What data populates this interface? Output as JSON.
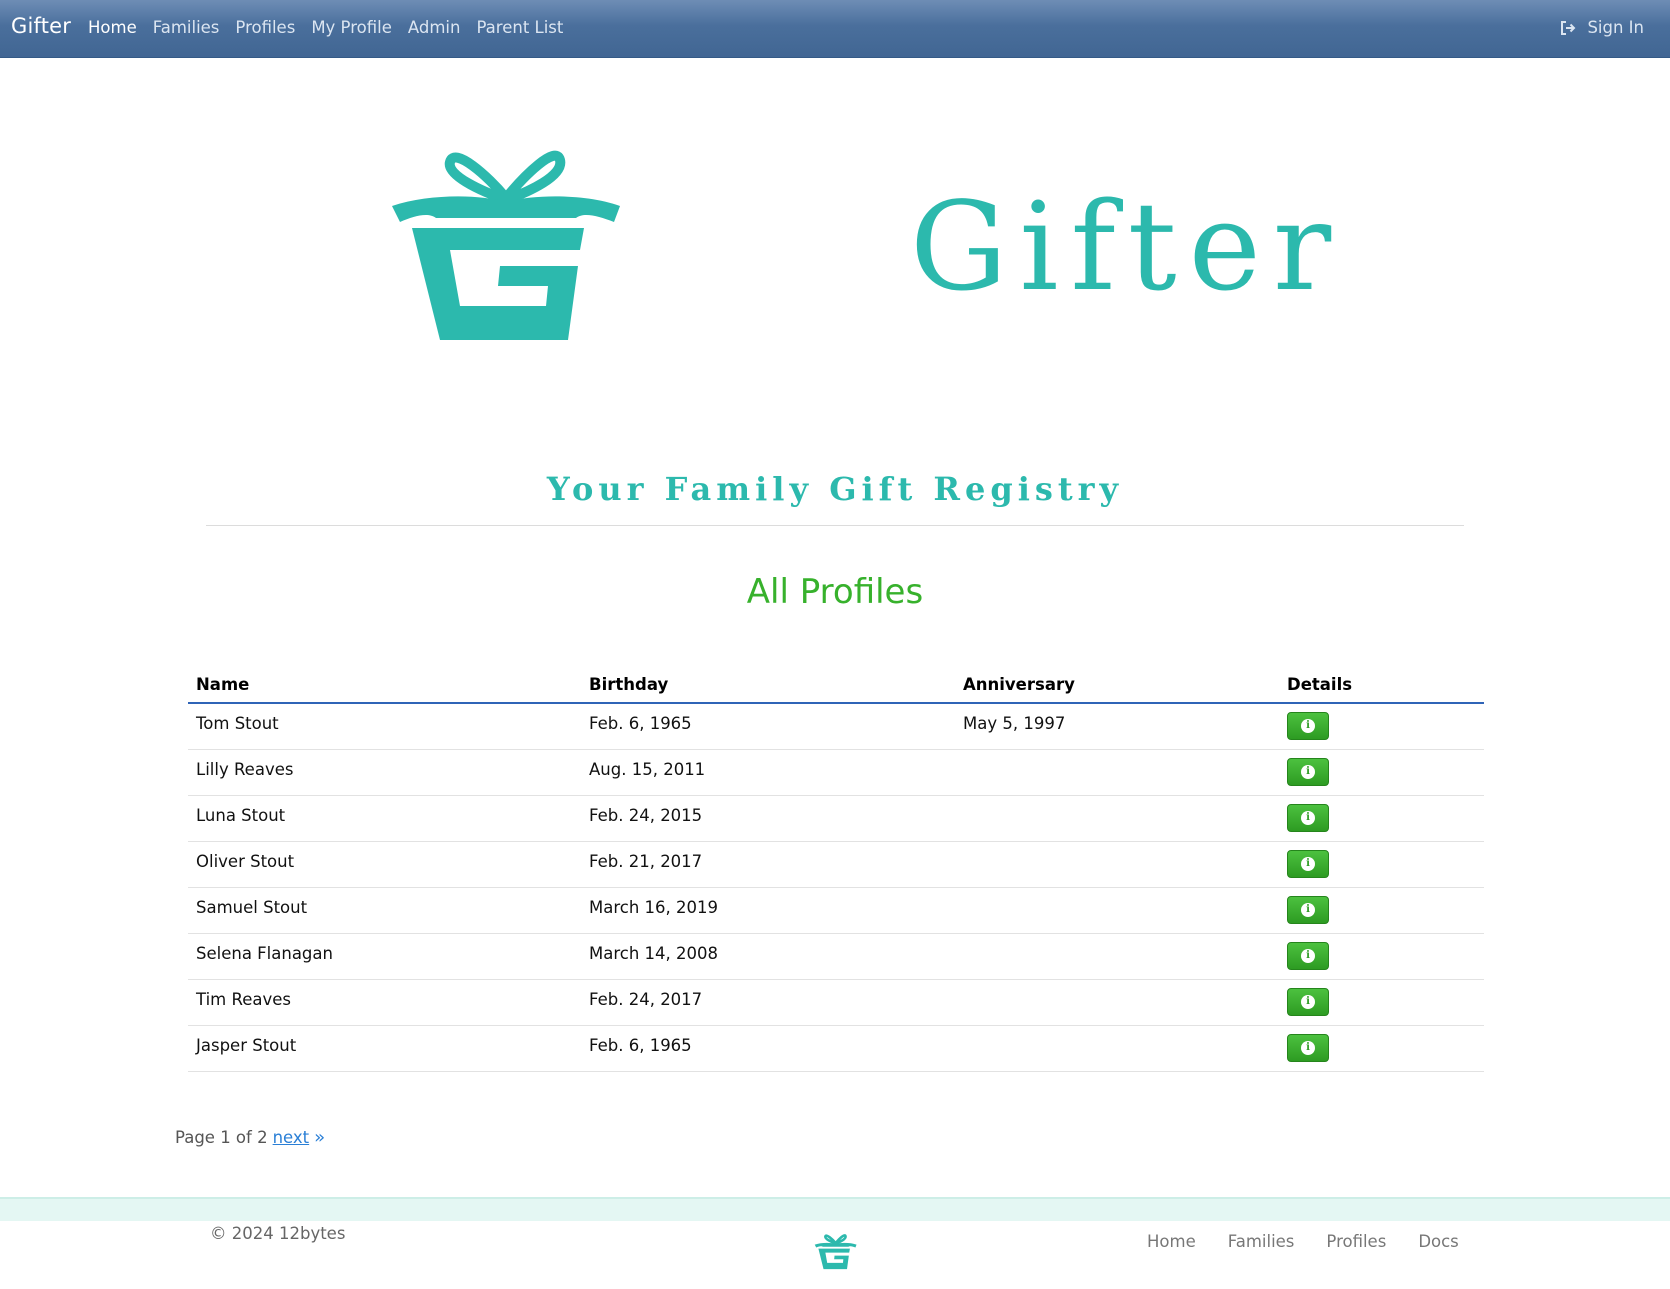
{
  "nav": {
    "brand": "Gifter",
    "links": [
      "Home",
      "Families",
      "Profiles",
      "My Profile",
      "Admin",
      "Parent List"
    ],
    "active": "Home",
    "signin_label": "Sign In"
  },
  "hero": {
    "wordmark": "Gifter",
    "tagline": "Your Family Gift Registry",
    "brand_color": "#2cb9ad"
  },
  "main": {
    "title": "All Profiles",
    "title_color": "#37b12c",
    "table": {
      "headers": [
        "Name",
        "Birthday",
        "Anniversary",
        "Details"
      ],
      "rows": [
        {
          "name": "Tom Stout",
          "birthday": "Feb. 6, 1965",
          "anniversary": "May 5, 1997"
        },
        {
          "name": "Lilly Reaves",
          "birthday": "Aug. 15, 2011",
          "anniversary": ""
        },
        {
          "name": "Luna Stout",
          "birthday": "Feb. 24, 2015",
          "anniversary": ""
        },
        {
          "name": "Oliver Stout",
          "birthday": "Feb. 21, 2017",
          "anniversary": ""
        },
        {
          "name": "Samuel Stout",
          "birthday": "March 16, 2019",
          "anniversary": ""
        },
        {
          "name": "Selena Flanagan",
          "birthday": "March 14, 2008",
          "anniversary": ""
        },
        {
          "name": "Tim Reaves",
          "birthday": "Feb. 24, 2017",
          "anniversary": ""
        },
        {
          "name": "Jasper Stout",
          "birthday": "Feb. 6, 1965",
          "anniversary": ""
        }
      ],
      "details_icon": "info-icon"
    },
    "pagination": {
      "text": "Page 1 of 2",
      "next_label": "next",
      "next_icon": "double-chevron-right-icon"
    }
  },
  "footer": {
    "copyright": "© 2024 12bytes",
    "links": [
      "Home",
      "Families",
      "Profiles",
      "Docs"
    ]
  }
}
